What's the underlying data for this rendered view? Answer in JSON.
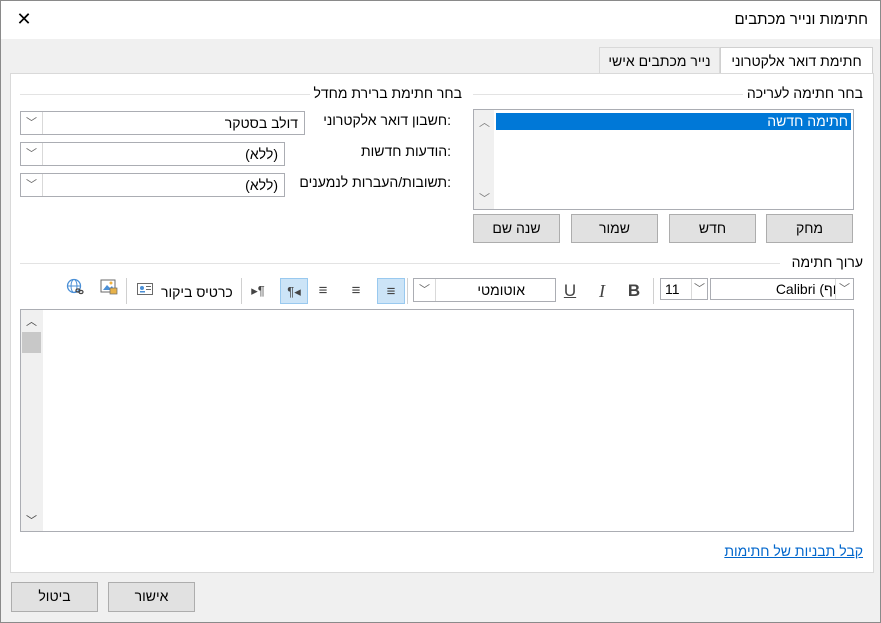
{
  "window": {
    "title": "חתימות ונייר מכתבים",
    "close_glyph": "✕"
  },
  "tabs": [
    {
      "label": "חתימת דואר אלקטרוני",
      "active": true
    },
    {
      "label": "נייר מכתבים אישי",
      "active": false
    }
  ],
  "edit_section": {
    "label": "בחר חתימה לעריכה",
    "signatures": [
      "חתימה חדשה"
    ],
    "selected": "חתימה חדשה",
    "buttons": {
      "delete": "מחק",
      "new": "חדש",
      "save": "שמור",
      "rename": "שנה שם"
    }
  },
  "default_section": {
    "label": "בחר חתימת ברירת מחדל",
    "account_label": "חשבון דואר אלקטרוני:",
    "account_value": "דולב בסטקר",
    "new_messages_label": "הודעות חדשות:",
    "new_messages_value": "(ללא)",
    "replies_label": "תשובות/העברות לנמענים:",
    "replies_value": "(ללא)"
  },
  "editor": {
    "label": "ערוך חתימה",
    "font": "Calibri (גוף)",
    "size": "11",
    "bold": "B",
    "italic": "I",
    "underline": "U",
    "color": "אוטומטי",
    "business_card": "כרטיס ביקור",
    "align_right_active": true,
    "rtl_active": true
  },
  "templates_link": "קבל תבניות של חתימות",
  "footer": {
    "ok": "אישור",
    "cancel": "ביטול"
  },
  "colors": {
    "accent": "#0078d7",
    "link": "#0066cc"
  }
}
